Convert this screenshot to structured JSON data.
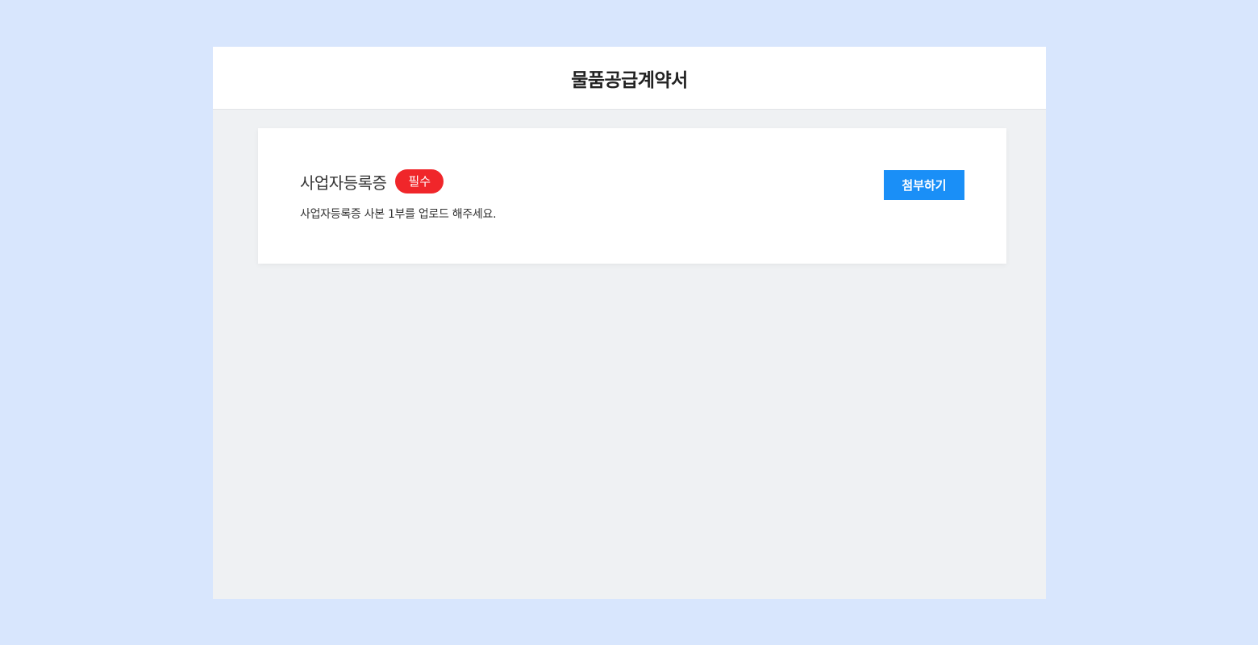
{
  "header": {
    "title": "물품공급계약서"
  },
  "document_item": {
    "title": "사업자등록증",
    "badge": "필수",
    "description": "사업자등록증 사본 1부를 업로드 해주세요.",
    "attach_label": "첨부하기"
  },
  "colors": {
    "page_background": "#d8e6fd",
    "panel_background": "#eff1f3",
    "badge": "#f0262a",
    "attach_button": "#1a8ff7"
  }
}
